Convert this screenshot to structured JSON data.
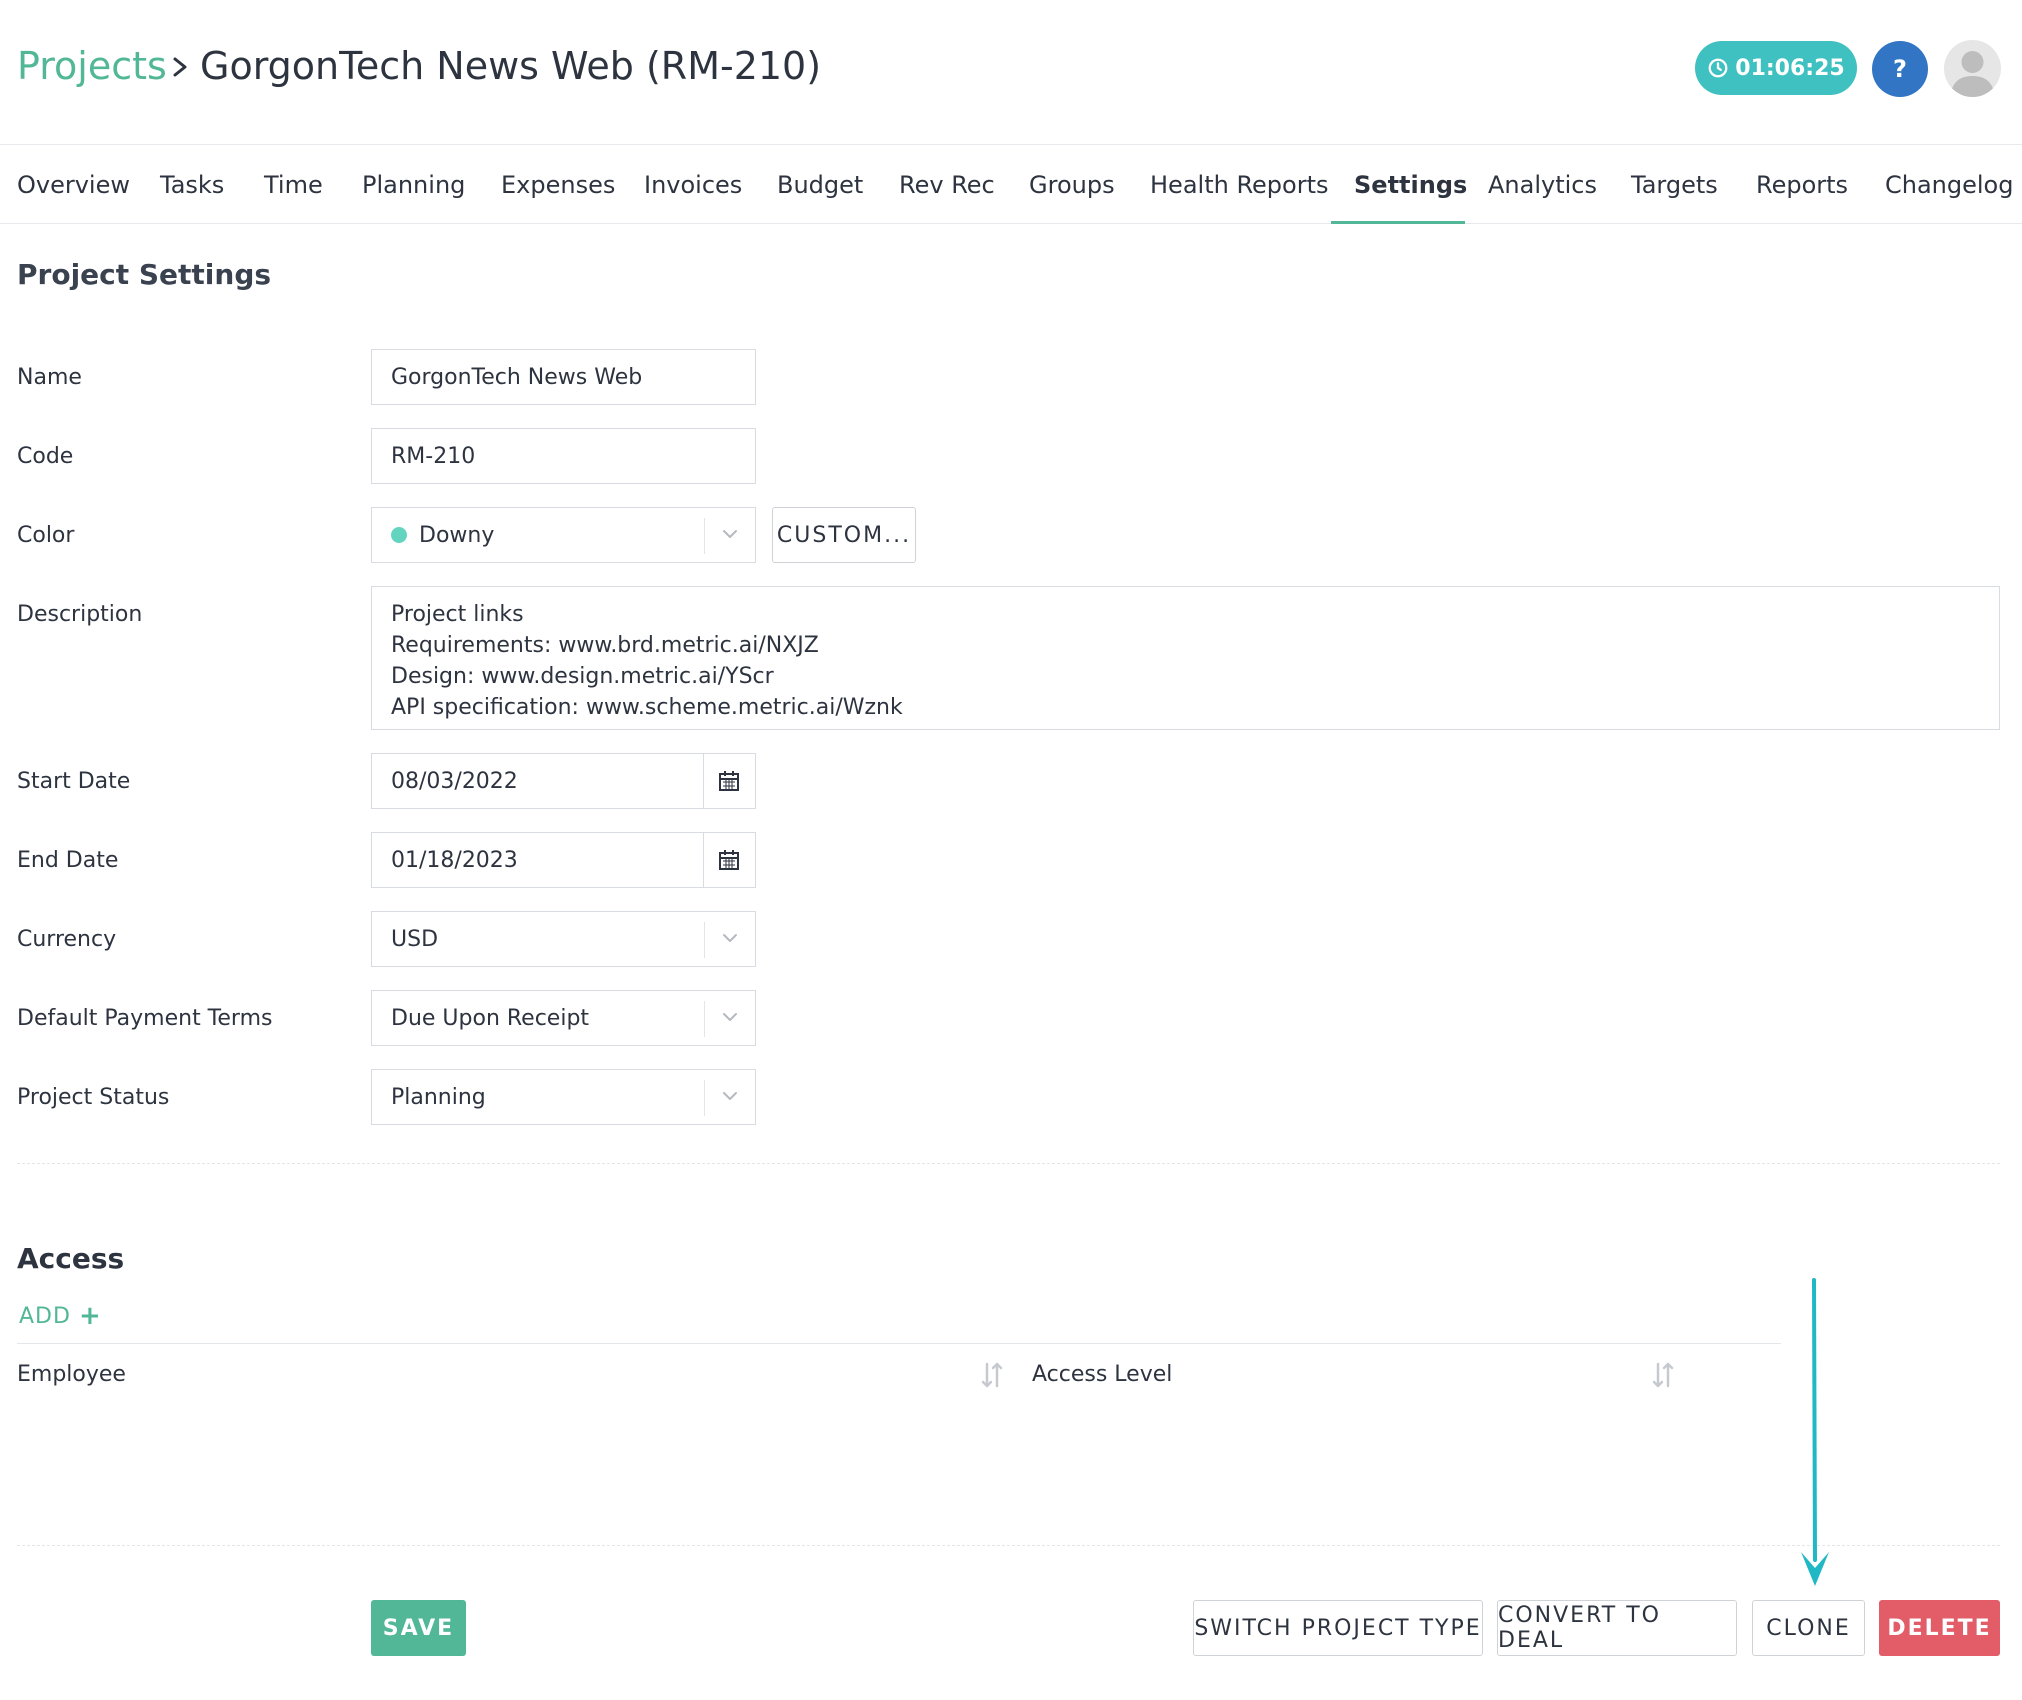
{
  "header": {
    "breadcrumb_root": "Projects",
    "project_title": "GorgonTech News Web (RM-210)",
    "timer": "01:06:25",
    "help_label": "?"
  },
  "tabs": [
    {
      "label": "Overview"
    },
    {
      "label": "Tasks"
    },
    {
      "label": "Time"
    },
    {
      "label": "Planning"
    },
    {
      "label": "Expenses"
    },
    {
      "label": "Invoices"
    },
    {
      "label": "Budget"
    },
    {
      "label": "Rev Rec"
    },
    {
      "label": "Groups"
    },
    {
      "label": "Health Reports"
    },
    {
      "label": "Settings",
      "active": true
    },
    {
      "label": "Analytics"
    },
    {
      "label": "Targets"
    },
    {
      "label": "Reports"
    },
    {
      "label": "Changelog"
    }
  ],
  "settings": {
    "title": "Project Settings",
    "name_label": "Name",
    "name_value": "GorgonTech News Web",
    "code_label": "Code",
    "code_value": "RM-210",
    "color_label": "Color",
    "color_value": "Downy",
    "color_hex": "#63d4c0",
    "custom_button": "CUSTOM...",
    "description_label": "Description",
    "description_lines": [
      "Project links",
      "Requirements: www.brd.metric.ai/NXJZ",
      "Design: www.design.metric.ai/YScr",
      "API specification: www.scheme.metric.ai/Wznk"
    ],
    "start_date_label": "Start Date",
    "start_date_value": "08/03/2022",
    "end_date_label": "End Date",
    "end_date_value": "01/18/2023",
    "currency_label": "Currency",
    "currency_value": "USD",
    "payment_terms_label": "Default Payment Terms",
    "payment_terms_value": "Due Upon Receipt",
    "status_label": "Project Status",
    "status_value": "Planning"
  },
  "access": {
    "title": "Access",
    "add_label": "ADD",
    "col_employee": "Employee",
    "col_access_level": "Access Level"
  },
  "actions": {
    "save": "SAVE",
    "switch_type": "SWITCH PROJECT TYPE",
    "convert": "CONVERT TO DEAL",
    "clone": "CLONE",
    "delete": "DELETE"
  },
  "colors": {
    "accent_green": "#52b796",
    "timer_teal": "#3ec1c0",
    "help_blue": "#3175c4",
    "delete_red": "#e25d68",
    "arrow_teal": "#1fb8c4"
  }
}
